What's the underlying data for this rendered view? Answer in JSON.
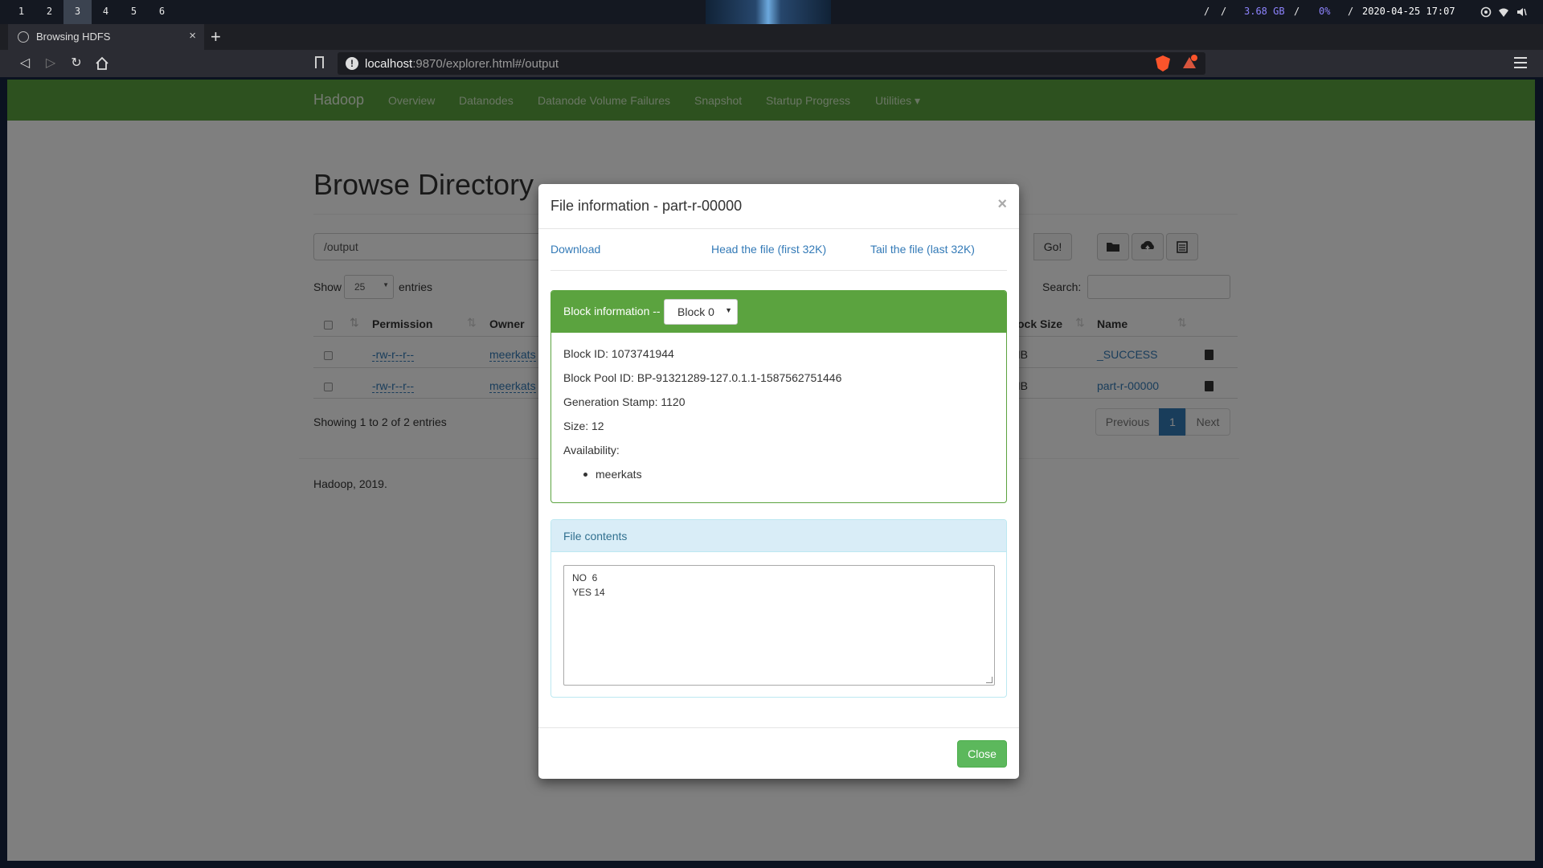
{
  "system_bar": {
    "workspaces": [
      "1",
      "2",
      "3",
      "4",
      "5",
      "6"
    ],
    "active_workspace": "3",
    "sep1": "/",
    "sep2": "/",
    "memory": "3.68 GB",
    "sep3": "/",
    "cpu": "0%",
    "sep4": "/",
    "datetime": "2020-04-25 17:07",
    "colors": {
      "memory": "#8e84ff",
      "cpu": "#8e84ff"
    }
  },
  "browser": {
    "tab_title": "Browsing HDFS",
    "tab_close": "×",
    "new_tab": "+",
    "url_host": "localhost",
    "url_rest": ":9870/explorer.html#/output",
    "icons": [
      "back-icon",
      "forward-icon",
      "reload-icon",
      "home-icon",
      "bookmark-icon",
      "info-icon",
      "brave-shield-icon",
      "brave-rewards-icon",
      "menu-icon"
    ]
  },
  "hadoop_nav": {
    "brand": "Hadoop",
    "items": [
      "Overview",
      "Datanodes",
      "Datanode Volume Failures",
      "Snapshot",
      "Startup Progress",
      "Utilities ▾"
    ]
  },
  "browse": {
    "title": "Browse Directory",
    "path_value": "/output",
    "go_label": "Go!",
    "show_label": "Show",
    "entries_per_page": "25",
    "entries_label": "entries",
    "search_label": "Search:",
    "columns": [
      "Permission",
      "Owner",
      "Block Size",
      "Name"
    ],
    "rows": [
      {
        "permission": "-rw-r--r--",
        "owner": "meerkats",
        "block_size": "MB",
        "name": "_SUCCESS"
      },
      {
        "permission": "-rw-r--r--",
        "owner": "meerkats",
        "block_size": "MB",
        "name": "part-r-00000"
      }
    ],
    "showing": "Showing 1 to 2 of 2 entries",
    "pager": {
      "previous": "Previous",
      "current": "1",
      "next": "Next"
    },
    "footer": "Hadoop, 2019."
  },
  "modal": {
    "title": "File information - part-r-00000",
    "close_x": "×",
    "links": {
      "download": "Download",
      "head": "Head the file (first 32K)",
      "tail": "Tail the file (last 32K)"
    },
    "block_info_label": "Block information --",
    "block_selected": "Block 0",
    "block_id": "Block ID: 1073741944",
    "block_pool_id": "Block Pool ID: BP-91321289-127.0.1.1-1587562751446",
    "generation_stamp": "Generation Stamp: 1120",
    "size": "Size: 12",
    "availability_label": "Availability:",
    "availability": [
      "meerkats"
    ],
    "file_contents_label": "File contents",
    "file_lines": [
      "NO  6",
      "YES 14"
    ],
    "close_label": "Close",
    "colors": {
      "success": "#5ba33f",
      "info_bg": "#d9edf7",
      "link": "#337ab7"
    }
  }
}
